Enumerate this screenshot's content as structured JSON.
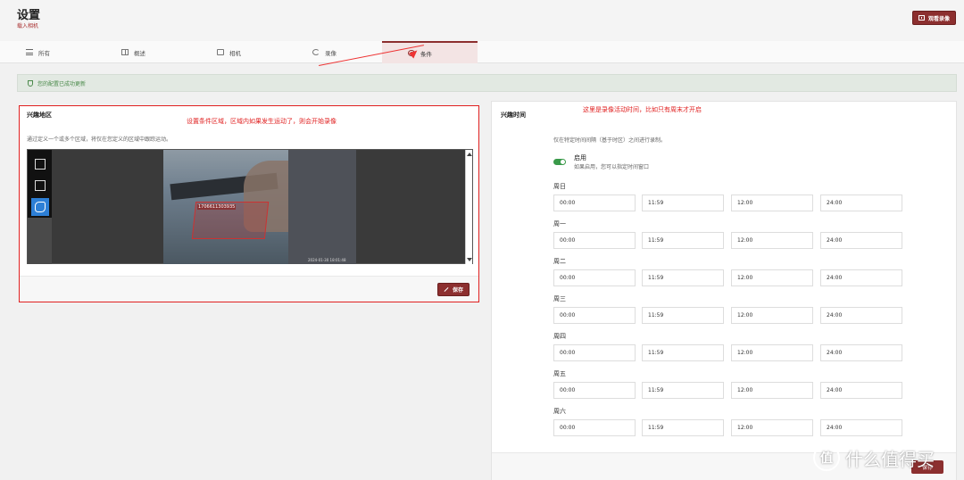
{
  "header": {
    "title": "设置",
    "subtitle": "载入相机",
    "action_button": "观看录像"
  },
  "tabs": [
    {
      "label": "所有",
      "icon": "list-icon"
    },
    {
      "label": "概述",
      "icon": "grid-icon"
    },
    {
      "label": "相机",
      "icon": "camera-icon"
    },
    {
      "label": "录像",
      "icon": "refresh-icon"
    },
    {
      "label": "条件",
      "icon": "eye-icon",
      "active": true
    }
  ],
  "alert": {
    "text": "您的配置已成功更新"
  },
  "roi": {
    "title": "兴趣地区",
    "annotation": "设置条件区域，区域内如果发生运动了，则会开始录像",
    "description": "通过定义一个或多个区域，将仅在您定义的区域中跟踪运动。",
    "region_label": "1706611303935",
    "timestamp": "2024-01-30 18:01:48",
    "save_button": "保存"
  },
  "schedule": {
    "title": "兴趣时间",
    "annotation": "这里是录像活动时间，比如只有周末才开启",
    "description": "仅在特定时间间隔（基于时区）之间进行录制。",
    "toggle_label": "启用",
    "toggle_help": "如果启用，您可以指定时间窗口",
    "enabled": true,
    "days": [
      {
        "name": "周日",
        "values": [
          "00:00",
          "11:59",
          "12:00",
          "24:00"
        ]
      },
      {
        "name": "周一",
        "values": [
          "00:00",
          "11:59",
          "12:00",
          "24:00"
        ]
      },
      {
        "name": "周二",
        "values": [
          "00:00",
          "11:59",
          "12:00",
          "24:00"
        ]
      },
      {
        "name": "周三",
        "values": [
          "00:00",
          "11:59",
          "12:00",
          "24:00"
        ]
      },
      {
        "name": "周四",
        "values": [
          "00:00",
          "11:59",
          "12:00",
          "24:00"
        ]
      },
      {
        "name": "周五",
        "values": [
          "00:00",
          "11:59",
          "12:00",
          "24:00"
        ]
      },
      {
        "name": "周六",
        "values": [
          "00:00",
          "11:59",
          "12:00",
          "24:00"
        ]
      }
    ],
    "save_button": "保存"
  },
  "watermark": {
    "logo": "值",
    "text": "什么值得买"
  },
  "colors": {
    "accent": "#8c2f2f",
    "success": "#4a8a4a",
    "annotation": "#e02020"
  }
}
